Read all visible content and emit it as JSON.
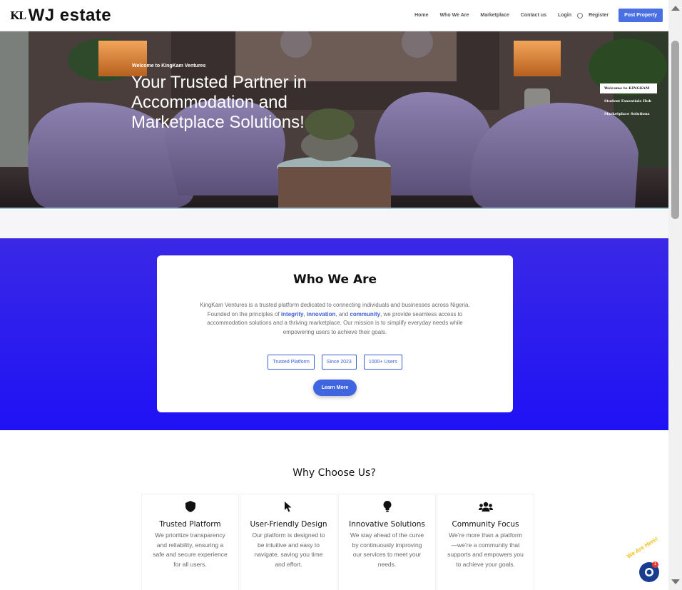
{
  "header": {
    "logo_mark": "KL",
    "logo_text": "WJ estate",
    "nav": [
      "Home",
      "Who We Are",
      "Marketplace",
      "Contact us"
    ],
    "login": "Login",
    "register": "Register",
    "post_property": "Post Property"
  },
  "hero": {
    "eyebrow": "Welcome to KingKam Ventures",
    "title": "Your Trusted Partner in Accommodation and Marketplace Solutions!",
    "side_menu": [
      "Welcome to KINGKAM",
      "Student Essentials Hub",
      "Marketplace Solutions"
    ]
  },
  "about": {
    "heading": "Who We Are",
    "text_1": "KingKam Ventures is a trusted platform dedicated to connecting individuals and businesses across Nigeria. Founded on the principles of ",
    "integrity": "integrity",
    "comma": ", ",
    "innovation": "innovation",
    "and": ", and ",
    "community": "community",
    "text_2": ", we provide seamless access to accommodation solutions and a thriving marketplace. Our mission is to simplify everyday needs while empowering users to achieve their goals.",
    "tags": [
      "Trusted Platform",
      "Since 2023",
      "1000+ Users"
    ],
    "learn_more": "Learn More"
  },
  "why": {
    "heading": "Why Choose Us?",
    "features": [
      {
        "icon": "shield-icon",
        "title": "Trusted Platform",
        "text": "We prioritize transparency and reliability, ensuring a safe and secure experience for all users."
      },
      {
        "icon": "cursor-icon",
        "title": "User-Friendly Design",
        "text": "Our platform is designed to be intuitive and easy to navigate, saving you time and effort."
      },
      {
        "icon": "lightbulb-icon",
        "title": "Innovative Solutions",
        "text": "We stay ahead of the curve by continuously improving our services to meet your needs."
      },
      {
        "icon": "users-icon",
        "title": "Community Focus",
        "text": "We’re more than a platform—we’re a community that supports and empowers you to achieve your goals."
      }
    ]
  },
  "chat": {
    "label": "We Are Here!",
    "badge": "1"
  },
  "colors": {
    "accent": "#3f66e0",
    "blue_section": "#2618f0"
  }
}
